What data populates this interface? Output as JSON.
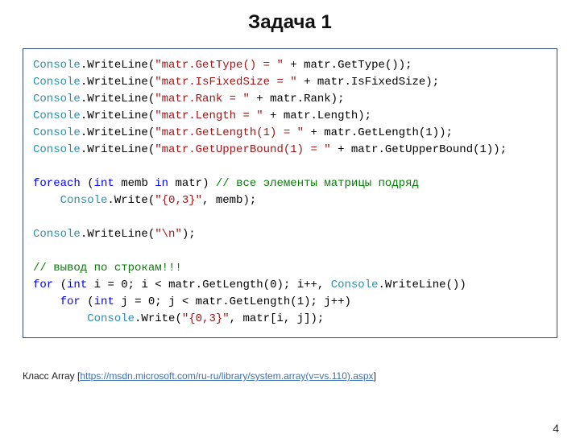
{
  "title": "Задача 1",
  "caption": {
    "prefix": "Класс Array [",
    "url": "https://msdn.microsoft.com/ru-ru/library/system.array(v=vs.110).aspx",
    "suffix": "]"
  },
  "page_number": "4",
  "code": {
    "lines": [
      {
        "t": [
          [
            "type",
            "Console"
          ],
          [
            "",
            ".WriteLine("
          ],
          [
            "str",
            "\"matr.GetType() = \""
          ],
          [
            "",
            " + matr.GetType());"
          ]
        ]
      },
      {
        "t": [
          [
            "type",
            "Console"
          ],
          [
            "",
            ".WriteLine("
          ],
          [
            "str",
            "\"matr.IsFixedSize = \""
          ],
          [
            "",
            " + matr.IsFixedSize);"
          ]
        ]
      },
      {
        "t": [
          [
            "type",
            "Console"
          ],
          [
            "",
            ".WriteLine("
          ],
          [
            "str",
            "\"matr.Rank = \""
          ],
          [
            "",
            " + matr.Rank);"
          ]
        ]
      },
      {
        "t": [
          [
            "type",
            "Console"
          ],
          [
            "",
            ".WriteLine("
          ],
          [
            "str",
            "\"matr.Length = \""
          ],
          [
            "",
            " + matr.Length);"
          ]
        ]
      },
      {
        "t": [
          [
            "type",
            "Console"
          ],
          [
            "",
            ".WriteLine("
          ],
          [
            "str",
            "\"matr.GetLength(1) = \""
          ],
          [
            "",
            " + matr.GetLength(1));"
          ]
        ]
      },
      {
        "t": [
          [
            "type",
            "Console"
          ],
          [
            "",
            ".WriteLine("
          ],
          [
            "str",
            "\"matr.GetUpperBound(1) = \""
          ],
          [
            "",
            " + matr.GetUpperBound(1));"
          ]
        ]
      },
      {
        "t": [
          [
            "",
            ""
          ]
        ]
      },
      {
        "t": [
          [
            "kw",
            "foreach"
          ],
          [
            "",
            " ("
          ],
          [
            "kw",
            "int"
          ],
          [
            "",
            " memb "
          ],
          [
            "kw",
            "in"
          ],
          [
            "",
            " matr) "
          ],
          [
            "cmt",
            "// все элементы матрицы подряд"
          ]
        ]
      },
      {
        "t": [
          [
            "",
            "    "
          ],
          [
            "type",
            "Console"
          ],
          [
            "",
            ".Write("
          ],
          [
            "str",
            "\"{0,3}\""
          ],
          [
            "",
            ", memb);"
          ]
        ]
      },
      {
        "t": [
          [
            "",
            ""
          ]
        ]
      },
      {
        "t": [
          [
            "type",
            "Console"
          ],
          [
            "",
            ".WriteLine("
          ],
          [
            "str",
            "\"\\n\""
          ],
          [
            "",
            ");"
          ]
        ]
      },
      {
        "t": [
          [
            "",
            ""
          ]
        ]
      },
      {
        "t": [
          [
            "cmt",
            "// вывод по строкам!!!"
          ]
        ]
      },
      {
        "t": [
          [
            "kw",
            "for"
          ],
          [
            "",
            " ("
          ],
          [
            "kw",
            "int"
          ],
          [
            "",
            " i = 0; i < matr.GetLength(0); i++, "
          ],
          [
            "type",
            "Console"
          ],
          [
            "",
            ".WriteLine())"
          ]
        ]
      },
      {
        "t": [
          [
            "",
            "    "
          ],
          [
            "kw",
            "for"
          ],
          [
            "",
            " ("
          ],
          [
            "kw",
            "int"
          ],
          [
            "",
            " j = 0; j < matr.GetLength(1); j++)"
          ]
        ]
      },
      {
        "t": [
          [
            "",
            "        "
          ],
          [
            "type",
            "Console"
          ],
          [
            "",
            ".Write("
          ],
          [
            "str",
            "\"{0,3}\""
          ],
          [
            "",
            ", matr[i, j]);"
          ]
        ]
      }
    ]
  }
}
